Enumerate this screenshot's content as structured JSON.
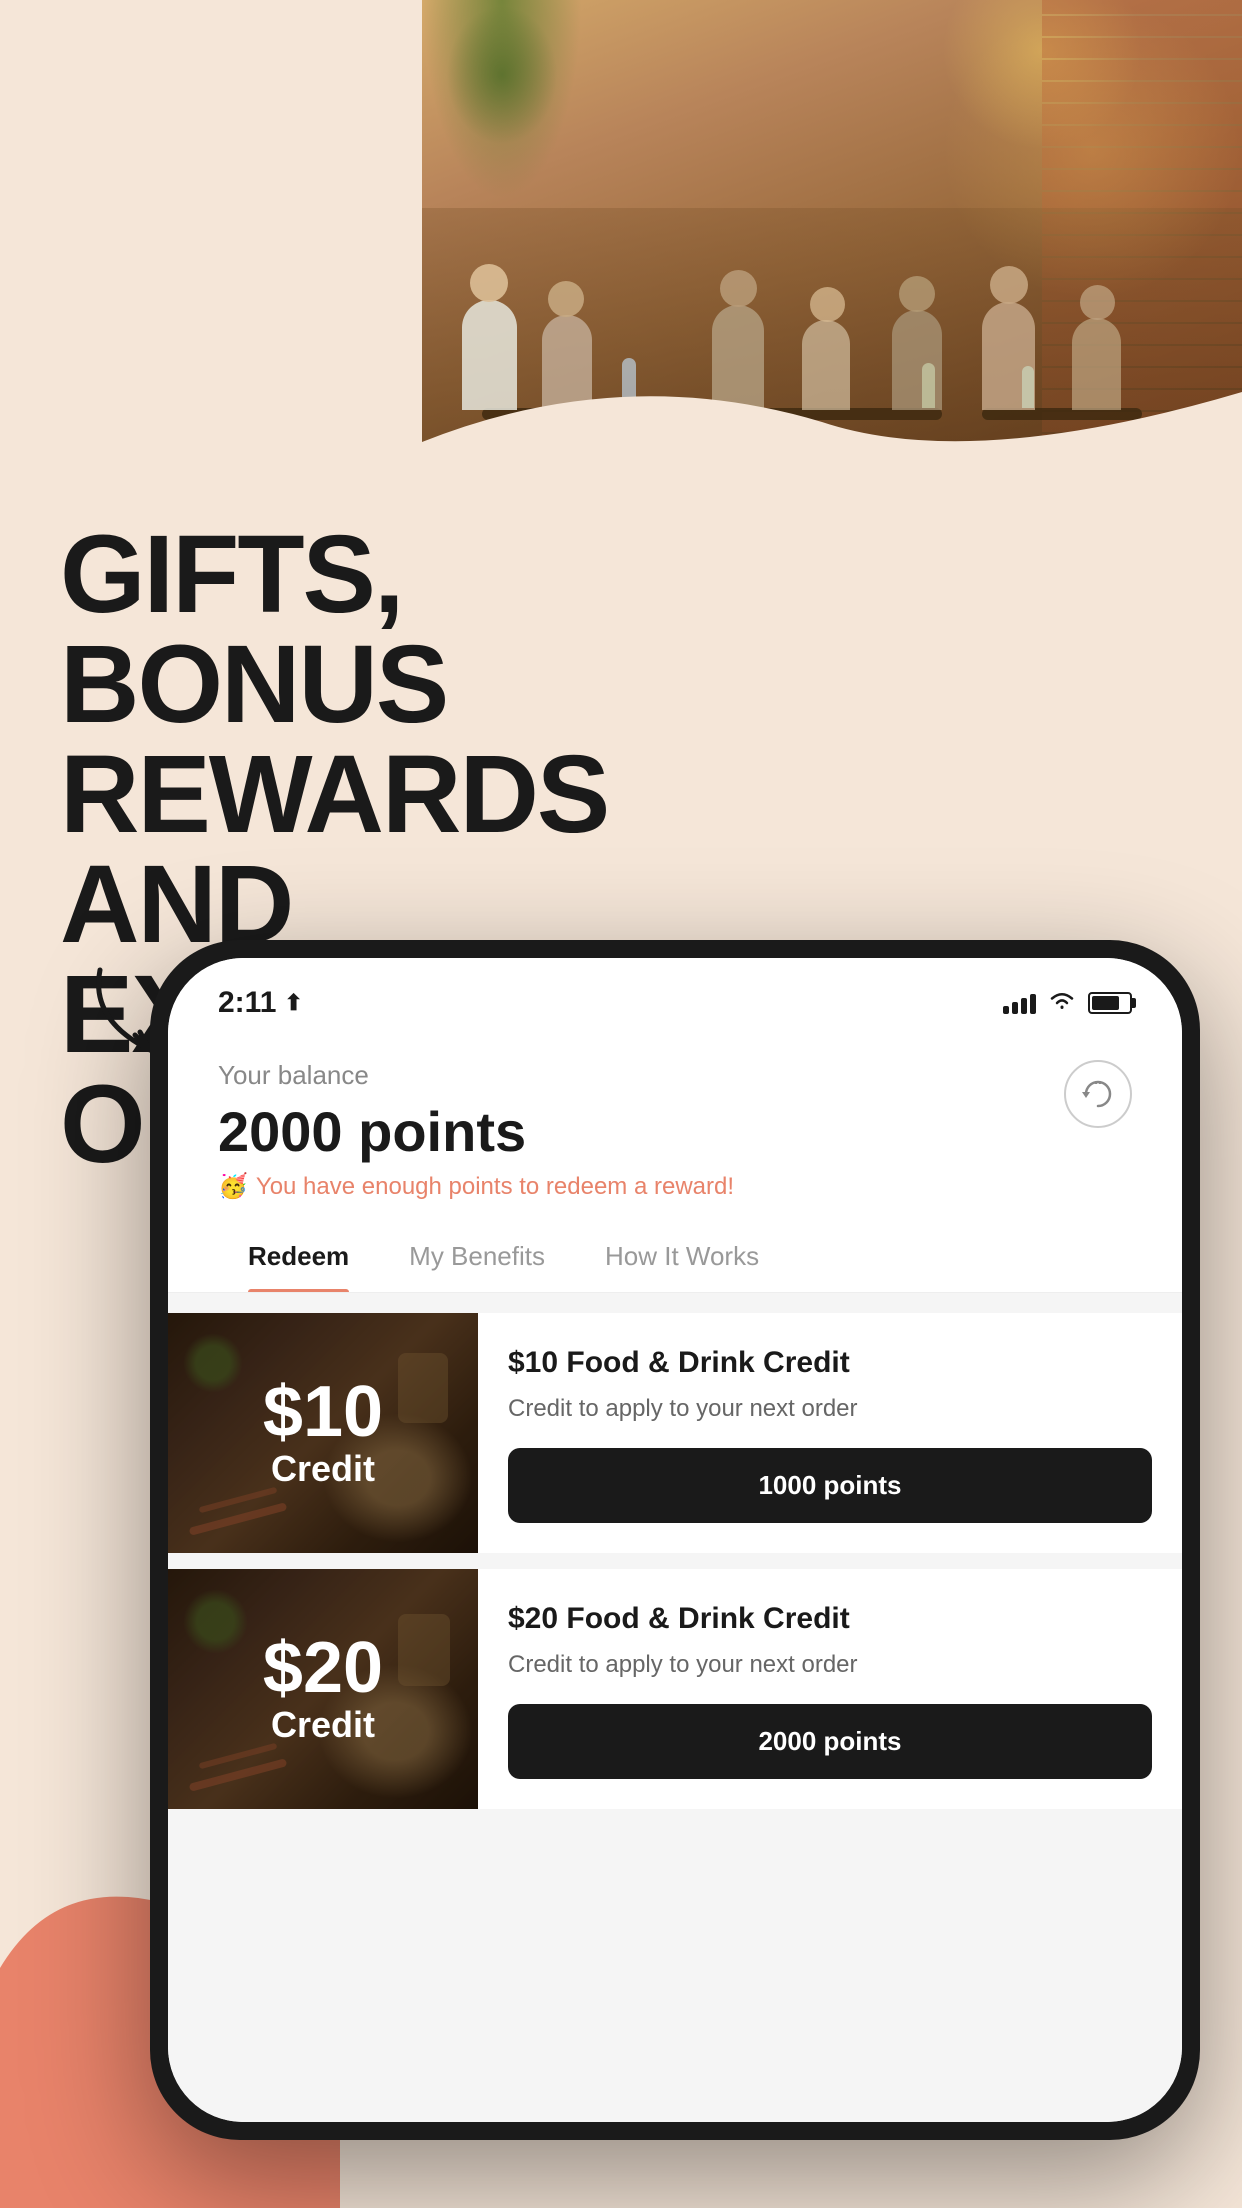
{
  "hero": {
    "background_color": "#f5e6d8",
    "blob_color": "#E8836A"
  },
  "headline": {
    "line1": "GIFTS, BONUS",
    "line2": "REWARDS AND",
    "line3": "EXCLUSIVE OFFERS"
  },
  "phone": {
    "status_bar": {
      "time": "2:11",
      "location_icon": "▷"
    },
    "balance": {
      "label": "Your balance",
      "amount": "2000 points",
      "message": "You have enough points to redeem a reward!",
      "emoji": "🥳"
    },
    "tabs": [
      {
        "id": "redeem",
        "label": "Redeem",
        "active": true
      },
      {
        "id": "my-benefits",
        "label": "My Benefits",
        "active": false
      },
      {
        "id": "how-it-works",
        "label": "How It Works",
        "active": false
      }
    ],
    "rewards": [
      {
        "id": "reward-10",
        "amount": "$10",
        "credit_label": "Credit",
        "title": "$10 Food & Drink Credit",
        "description": "Credit to apply to your next order",
        "points_label": "1000 points"
      },
      {
        "id": "reward-20",
        "amount": "$20",
        "credit_label": "Credit",
        "title": "$20 Food & Drink Credit",
        "description": "Credit to apply to your next order",
        "points_label": "2000 points"
      }
    ]
  }
}
